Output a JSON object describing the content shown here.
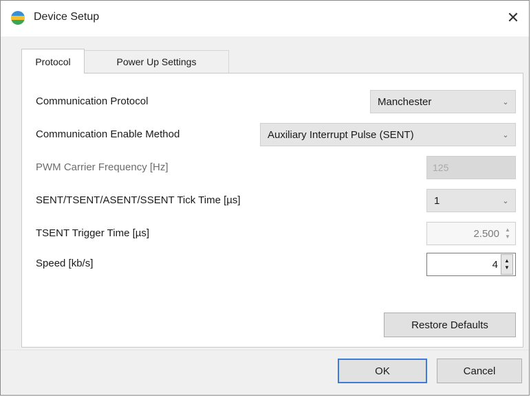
{
  "window": {
    "title": "Device Setup",
    "icon": "globe-app-icon",
    "close_glyph": "✕"
  },
  "tabs": [
    {
      "label": "Protocol",
      "active": true
    },
    {
      "label": "Power Up Settings",
      "active": false
    }
  ],
  "fields": {
    "communication_protocol": {
      "label": "Communication Protocol",
      "value": "Manchester"
    },
    "communication_enable_method": {
      "label": "Communication Enable Method",
      "value": "Auxiliary Interrupt Pulse (SENT)"
    },
    "pwm_carrier_frequency": {
      "label": "PWM Carrier Frequency [Hz]",
      "value": "125",
      "enabled": false
    },
    "tick_time": {
      "label": "SENT/TSENT/ASENT/SSENT Tick Time [µs]",
      "value": "1"
    },
    "tsent_trigger_time": {
      "label": "TSENT Trigger Time [µs]",
      "value": "2.500",
      "enabled": false
    },
    "speed": {
      "label": "Speed [kb/s]",
      "value": "4"
    }
  },
  "buttons": {
    "restore_defaults": "Restore Defaults",
    "ok": "OK",
    "cancel": "Cancel"
  },
  "icons": {
    "chevron": "chevron-down-icon",
    "spin_up": "▲",
    "spin_down": "▼"
  },
  "colors": {
    "dialog_bg": "#f0f0f0",
    "default_button_border": "#3d7bd6"
  }
}
